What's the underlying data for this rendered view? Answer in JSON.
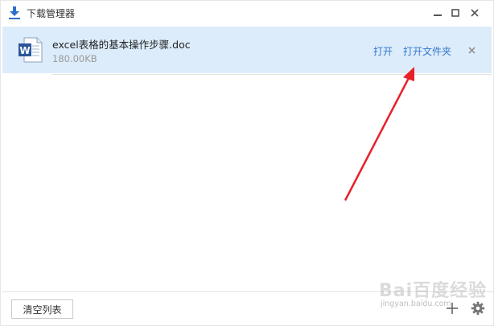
{
  "window": {
    "title": "下载管理器",
    "icons": {
      "title": "download-arrow-icon",
      "minimize": "minimize-icon",
      "maximize": "maximize-icon",
      "close": "close-icon"
    }
  },
  "downloads": [
    {
      "file_name": "excel表格的基本操作步骤.doc",
      "size": "180.00KB",
      "icon": "word-doc-icon",
      "actions": {
        "open": "打开",
        "open_folder": "打开文件夹"
      }
    }
  ],
  "footer": {
    "clear_list_label": "清空列表",
    "icons": {
      "add": "plus-icon",
      "settings": "gear-icon"
    }
  },
  "watermark": {
    "main": "Bai百度经验",
    "sub": "jingyan.baidu.com"
  },
  "colors": {
    "selected_row": "#dcecfb",
    "link": "#3377cc",
    "arrow": "#e8202a",
    "title_icon": "#2f6fcc"
  }
}
